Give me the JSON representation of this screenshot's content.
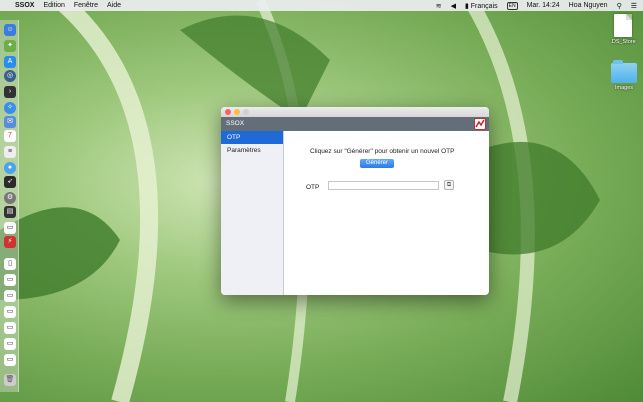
{
  "menubar": {
    "apple_icon": "apple-logo-icon",
    "app_name": "SSOX",
    "menus": [
      "Edition",
      "Fenêtre",
      "Aide"
    ],
    "language": "Français",
    "input_source": "EN",
    "clock": "Mar. 14:24",
    "user": "Hoa Nguyen"
  },
  "desktop": {
    "file_label": ".DS_Store",
    "folder_label": "Images"
  },
  "window": {
    "title": "SSOX",
    "sidebar": {
      "items": [
        "OTP",
        "Paramètres"
      ],
      "selected": "OTP"
    },
    "main": {
      "hint": "Cliquez sur \"Générer\" pour obtenir un nouvel OTP",
      "generate_label": "Générer",
      "otp_label": "OTP",
      "otp_value": ""
    }
  },
  "colors": {
    "accent": "#1e6ad6",
    "header": "#646e7a",
    "button": "#2f7be8"
  }
}
